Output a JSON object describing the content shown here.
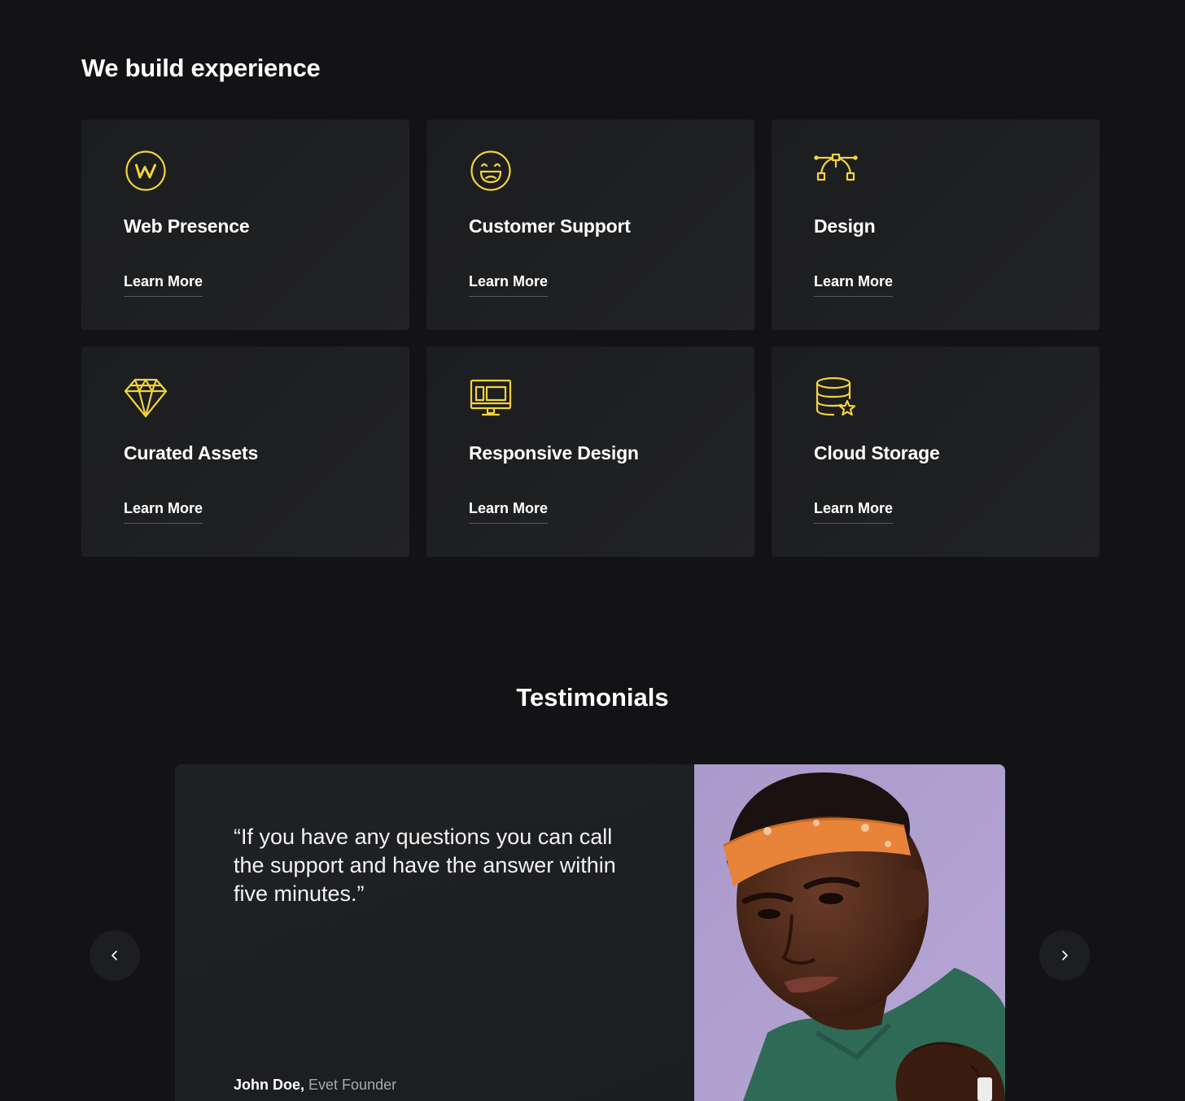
{
  "colors": {
    "background": "#131315",
    "card": "#1f2022",
    "accent_icon": "#f2d33c",
    "text": "#ffffff",
    "muted_text": "#a9a9ab"
  },
  "services": {
    "heading": "We build experience",
    "cards": [
      {
        "icon": "web-presence-icon",
        "title": "Web Presence",
        "link_label": "Learn More"
      },
      {
        "icon": "smiley-face-icon",
        "title": "Customer Support",
        "link_label": "Learn More"
      },
      {
        "icon": "bezier-pen-icon",
        "title": "Design",
        "link_label": "Learn More"
      },
      {
        "icon": "diamond-icon",
        "title": "Curated Assets",
        "link_label": "Learn More"
      },
      {
        "icon": "monitor-layout-icon",
        "title": "Responsive Design",
        "link_label": "Learn More"
      },
      {
        "icon": "database-star-icon",
        "title": "Cloud Storage",
        "link_label": "Learn More"
      }
    ]
  },
  "testimonials": {
    "heading": "Testimonials",
    "quote": "“If you have any questions you can call the support and have the answer within five minutes.”",
    "author_name": "John Doe,",
    "author_role": "Evet Founder",
    "photo": "portrait-man-orange-headband",
    "prev_icon": "chevron-left-icon",
    "next_icon": "chevron-right-icon"
  }
}
